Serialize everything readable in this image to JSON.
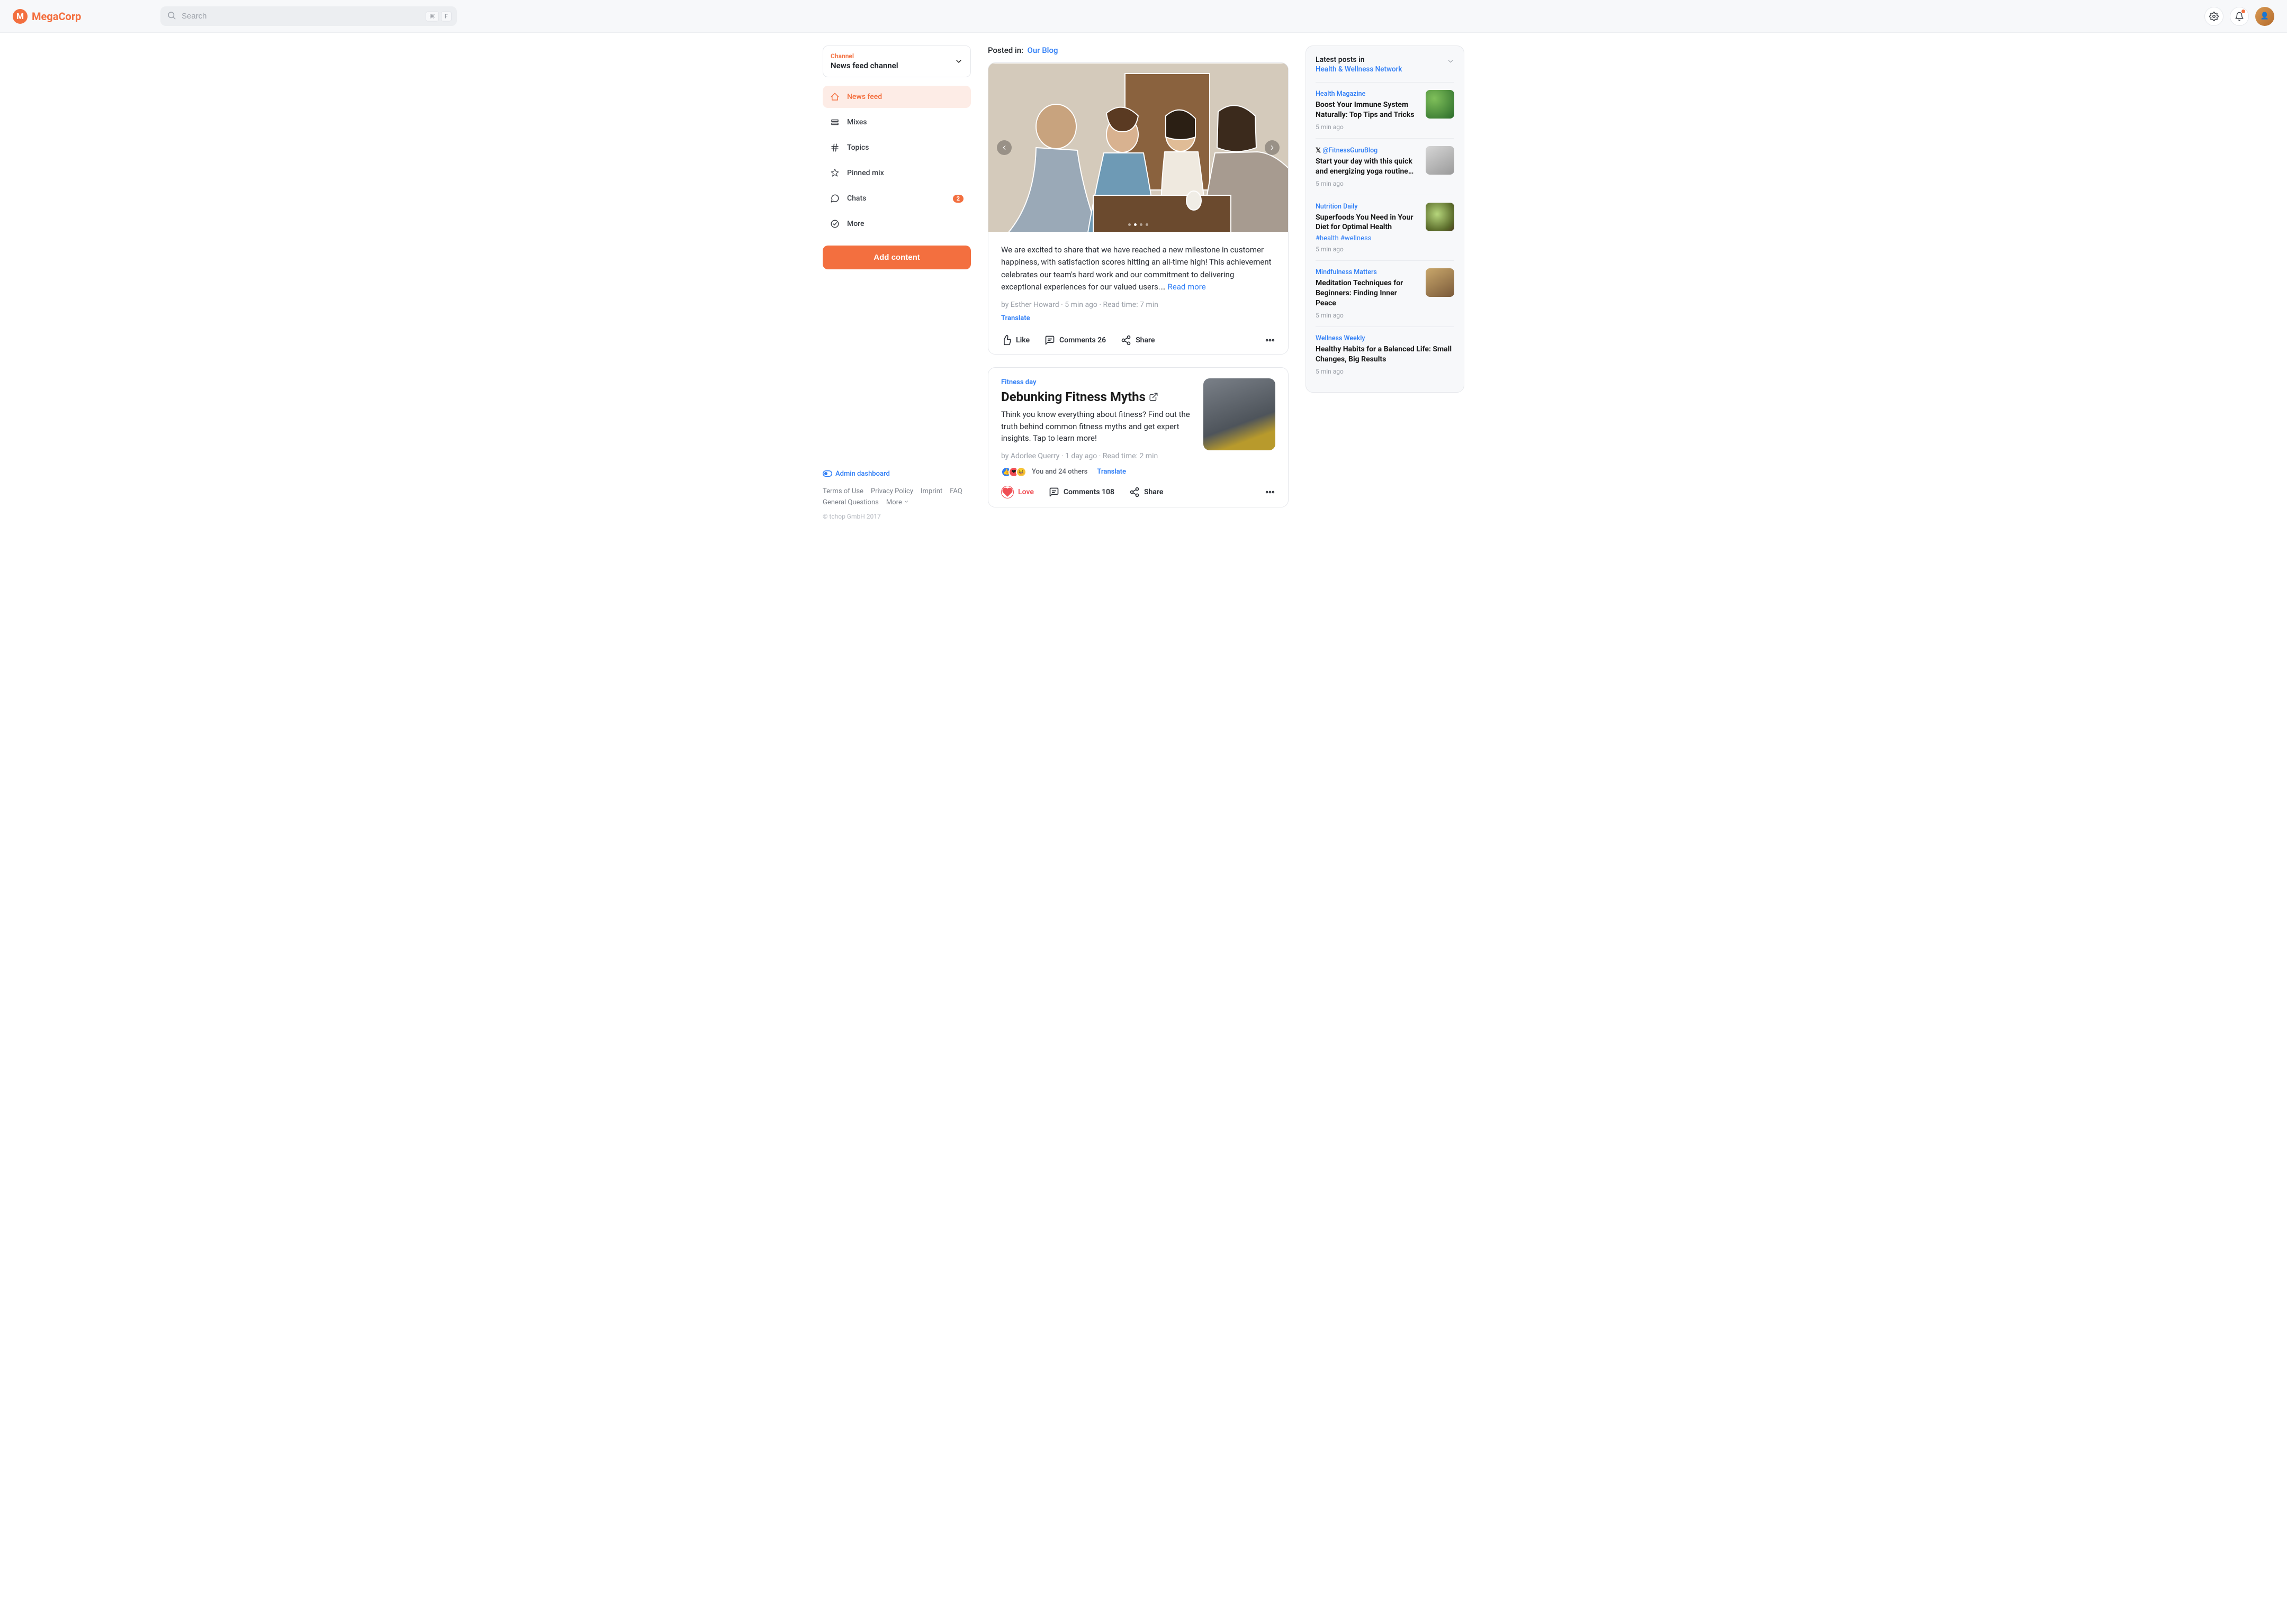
{
  "brand": {
    "name": "MegaCorp",
    "mark": "M"
  },
  "search": {
    "placeholder": "Search",
    "kbd1": "⌘",
    "kbd2": "F"
  },
  "sidebar": {
    "channel_label": "Channel",
    "channel_value": "News feed channel",
    "items": [
      {
        "label": "News feed"
      },
      {
        "label": "Mixes"
      },
      {
        "label": "Topics"
      },
      {
        "label": "Pinned mix"
      },
      {
        "label": "Chats",
        "badge": "2"
      },
      {
        "label": "More"
      }
    ],
    "add_button": "Add content",
    "admin_link": "Admin dashboard",
    "footer_links": [
      "Terms of Use",
      "Privacy Policy",
      "Imprint",
      "FAQ",
      "General Questions",
      "More"
    ],
    "copyright": "© tchop GmbH 2017"
  },
  "post1": {
    "posted_in_label": "Posted in:",
    "posted_in_link": "Our Blog",
    "excerpt": "We are excited to share that we have reached a new milestone in customer happiness, with satisfaction scores hitting an all-time high! This achievement celebrates our team's hard work and our commitment to delivering exceptional experiences for our valued users.…",
    "read_more": "Read more",
    "meta": "by Esther Howard · 5 min ago · Read time: 7 min",
    "translate": "Translate",
    "like": "Like",
    "comments": "Comments 26",
    "share": "Share"
  },
  "post2": {
    "category": "Fitness day",
    "title": "Debunking Fitness Myths",
    "excerpt": "Think you know everything about fitness? Find out the truth behind common fitness myths and get expert insights. Tap to learn more!",
    "meta": "by Adorlee Querry · 1 day ago · Read time: 2 min",
    "reactions_text": "You and 24 others",
    "translate": "Translate",
    "love": "Love",
    "comments": "Comments 108",
    "share": "Share"
  },
  "rightcol": {
    "title": "Latest posts in",
    "subtitle": "Health & Wellness Network",
    "items": [
      {
        "source": "Health Magazine",
        "title": "Boost Your Immune System Naturally: Top Tips and Tricks",
        "time": "5 min ago"
      },
      {
        "source": "@FitnessGuruBlog",
        "title": "Start your day with this quick and energizing yoga routine…",
        "time": "5 min ago",
        "x": true
      },
      {
        "source": "Nutrition Daily",
        "title": "Superfoods You Need in Your Diet for Optimal Health",
        "tags": "#health #wellness",
        "time": "5 min ago"
      },
      {
        "source": "Mindfulness Matters",
        "title": "Meditation Techniques for Beginners: Finding Inner Peace",
        "time": "5 min ago"
      },
      {
        "source": "Wellness Weekly",
        "title": "Healthy Habits for a Balanced Life: Small Changes, Big Results",
        "time": "5 min ago"
      }
    ]
  }
}
